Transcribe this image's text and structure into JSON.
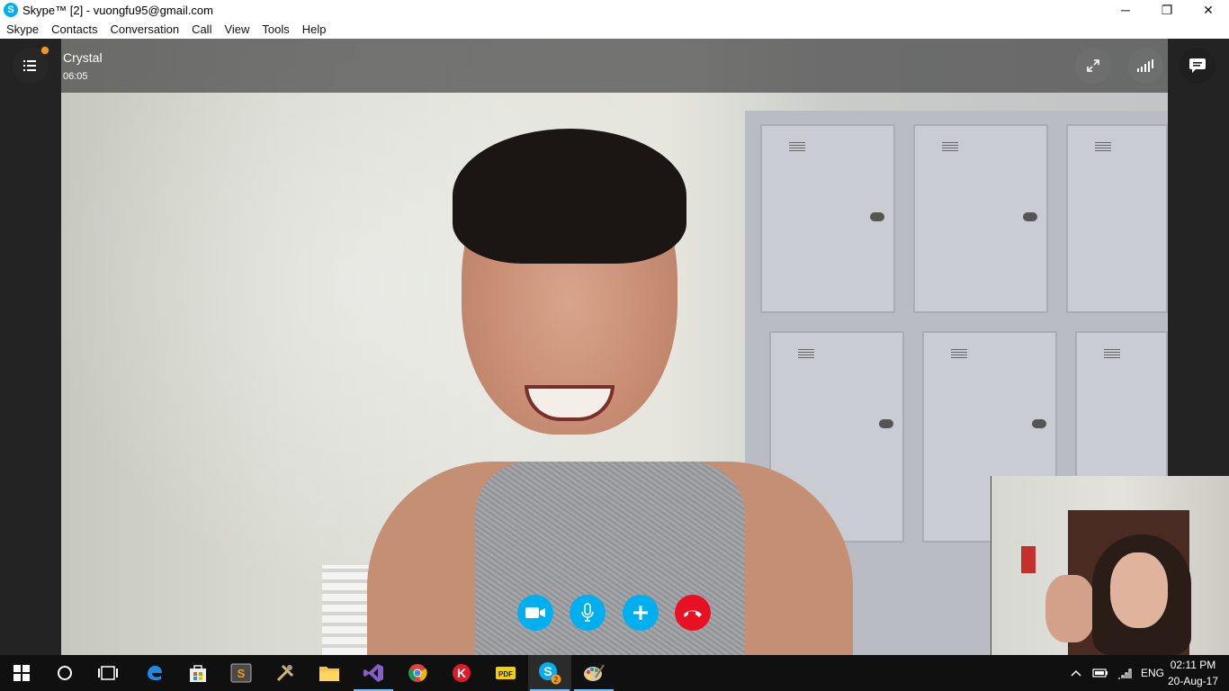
{
  "window": {
    "title": "Skype™ [2] - vuongfu95@gmail.com",
    "app_icon": "skype-icon",
    "minimize": "─",
    "maximize": "❐",
    "close": "✕"
  },
  "menu": {
    "items": [
      "Skype",
      "Contacts",
      "Conversation",
      "Call",
      "View",
      "Tools",
      "Help"
    ]
  },
  "call": {
    "contact_name": "Crystal",
    "duration": "06:05",
    "left_button_icon": "list-menu-icon",
    "notification_color": "#f69a1b",
    "fullscreen_icon": "expand-icon",
    "quality_icon": "signal-bars-icon",
    "chat_icon": "chat-bubble-icon"
  },
  "controls": [
    {
      "name": "video",
      "icon": "video-camera-icon",
      "color": "#00aff0"
    },
    {
      "name": "mute",
      "icon": "microphone-icon",
      "color": "#00aff0"
    },
    {
      "name": "add",
      "icon": "plus-icon",
      "color": "#00aff0"
    },
    {
      "name": "end-call",
      "icon": "hang-up-icon",
      "color": "#e81123"
    }
  ],
  "taskbar": {
    "apps": [
      {
        "name": "start",
        "icon": "windows-icon"
      },
      {
        "name": "search",
        "icon": "cortana-circle-icon"
      },
      {
        "name": "task-view",
        "icon": "task-view-icon"
      },
      {
        "name": "edge",
        "icon": "edge-icon"
      },
      {
        "name": "store",
        "icon": "store-icon"
      },
      {
        "name": "sublime",
        "icon": "sublime-text-icon"
      },
      {
        "name": "tools",
        "icon": "tools-icon"
      },
      {
        "name": "file-explorer",
        "icon": "folder-icon"
      },
      {
        "name": "visual-studio",
        "icon": "visual-studio-icon"
      },
      {
        "name": "chrome",
        "icon": "chrome-icon"
      },
      {
        "name": "k-app",
        "icon": "k-letter-icon"
      },
      {
        "name": "pdf-reader",
        "icon": "pdf-icon"
      },
      {
        "name": "skype",
        "icon": "skype-icon",
        "badge": "2"
      },
      {
        "name": "paint",
        "icon": "paint-palette-icon"
      }
    ],
    "tray": {
      "language": "ENG",
      "time": "02:11 PM",
      "date": "20-Aug-17"
    }
  }
}
